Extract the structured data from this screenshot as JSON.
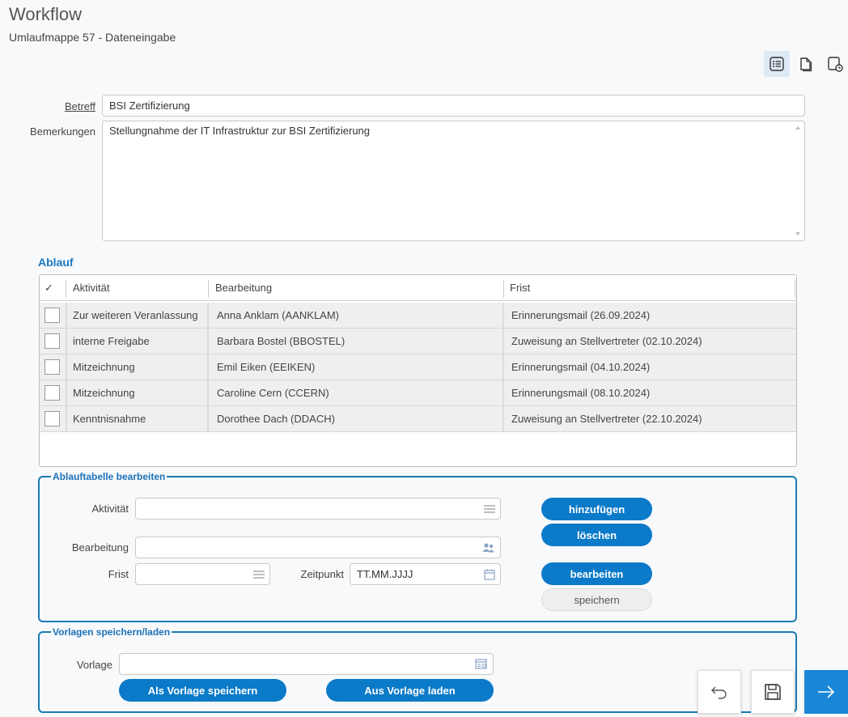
{
  "header": {
    "title": "Workflow",
    "subtitle": "Umlaufmappe 57 - Dateneingabe"
  },
  "toolbar": {
    "icons": [
      "list-view-icon",
      "document-icon",
      "document-clock-icon"
    ]
  },
  "form": {
    "betreff_label": "Betreff",
    "betreff_value": "BSI Zertifizierung",
    "bemerkungen_label": "Bemerkungen",
    "bemerkungen_value": "Stellungnahme der IT Infrastruktur zur BSI Zertifizierung"
  },
  "ablauf": {
    "section_title": "Ablauf",
    "columns": {
      "check": "✓",
      "activity": "Aktivität",
      "processing": "Bearbeitung",
      "deadline": "Frist"
    },
    "rows": [
      {
        "activity": "Zur weiteren Veranlassung",
        "processing": "Anna Anklam (AANKLAM)",
        "deadline": "Erinnerungsmail (26.09.2024)"
      },
      {
        "activity": "interne Freigabe",
        "processing": "Barbara Bostel (BBOSTEL)",
        "deadline": "Zuweisung an Stellvertreter (02.10.2024)"
      },
      {
        "activity": "Mitzeichnung",
        "processing": "Emil Eiken (EEIKEN)",
        "deadline": "Erinnerungsmail (04.10.2024)"
      },
      {
        "activity": "Mitzeichnung",
        "processing": "Caroline Cern (CCERN)",
        "deadline": "Erinnerungsmail (08.10.2024)"
      },
      {
        "activity": "Kenntnisnahme",
        "processing": "Dorothee Dach (DDACH)",
        "deadline": "Zuweisung an Stellvertreter (22.10.2024)"
      }
    ]
  },
  "edit_table": {
    "legend": "Ablauftabelle bearbeiten",
    "activity_label": "Aktivität",
    "activity_value": "",
    "processing_label": "Bearbeitung",
    "processing_value": "",
    "deadline_label": "Frist",
    "deadline_value": "",
    "time_label": "Zeitpunkt",
    "time_placeholder": "TT.MM.JJJJ",
    "add_button": "hinzufügen",
    "delete_button": "löschen",
    "edit_button": "bearbeiten",
    "save_button": "speichern"
  },
  "templates": {
    "legend": "Vorlagen speichern/laden",
    "template_label": "Vorlage",
    "template_value": "",
    "save_template_button": "Als Vorlage speichern",
    "load_template_button": "Aus Vorlage laden"
  },
  "nav": {
    "icons": [
      "undo-icon",
      "save-icon",
      "arrow-right-icon"
    ]
  },
  "colors": {
    "accent": "#0b7ac8",
    "fieldset_border": "#1c7ab2",
    "active_toolbar_bg": "#dde9f5"
  }
}
